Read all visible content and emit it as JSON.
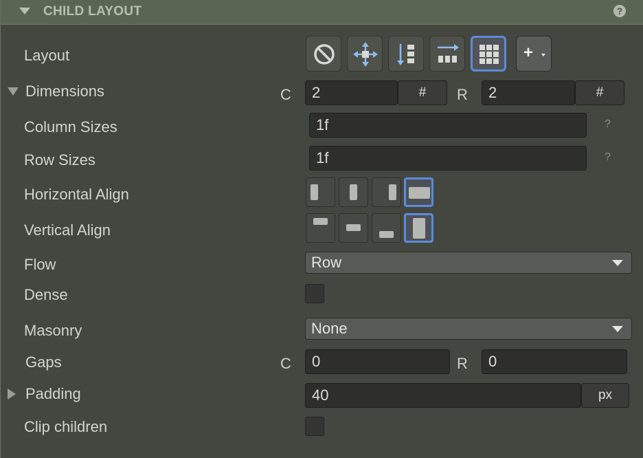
{
  "header": {
    "title": "CHILD LAYOUT",
    "help_glyph": "?"
  },
  "rows": {
    "layout": "Layout",
    "dimensions": "Dimensions",
    "column_sizes": "Column Sizes",
    "row_sizes": "Row Sizes",
    "horizontal_align": "Horizontal Align",
    "vertical_align": "Vertical Align",
    "flow": "Flow",
    "dense": "Dense",
    "masonry": "Masonry",
    "gaps": "Gaps",
    "padding": "Padding",
    "clip_children": "Clip children"
  },
  "layout_modes": [
    {
      "name": "none",
      "icon": "no-layout-icon"
    },
    {
      "name": "absolute",
      "icon": "move-arrows-icon"
    },
    {
      "name": "vertical-stack",
      "icon": "vertical-stack-icon"
    },
    {
      "name": "horizontal-stack",
      "icon": "horizontal-stack-icon"
    },
    {
      "name": "grid",
      "icon": "grid-icon",
      "selected": true
    },
    {
      "name": "add",
      "icon": "plus-dropdown-icon",
      "glyph": "+"
    }
  ],
  "dimensions": {
    "c_label": "C",
    "c_value": "2",
    "c_unit": "#",
    "r_label": "R",
    "r_value": "2",
    "r_unit": "#"
  },
  "column_sizes": {
    "value": "1f",
    "hint": "?"
  },
  "row_sizes": {
    "value": "1f",
    "hint": "?"
  },
  "horizontal_align": {
    "selected_index": 3,
    "options": [
      "left",
      "center",
      "right",
      "stretch"
    ]
  },
  "vertical_align": {
    "selected_index": 3,
    "options": [
      "top",
      "center",
      "bottom",
      "stretch"
    ]
  },
  "flow": {
    "value": "Row"
  },
  "dense": {
    "checked": false
  },
  "masonry": {
    "value": "None"
  },
  "gaps": {
    "c_label": "C",
    "c_value": "0",
    "r_label": "R",
    "r_value": "0"
  },
  "padding": {
    "value": "40",
    "unit": "px"
  },
  "clip_children": {
    "checked": false
  },
  "colors": {
    "accent": "#5d8bdc",
    "icon_blue": "#8bbcf0",
    "header_bg": "#5a6652",
    "panel_bg": "#444640"
  }
}
